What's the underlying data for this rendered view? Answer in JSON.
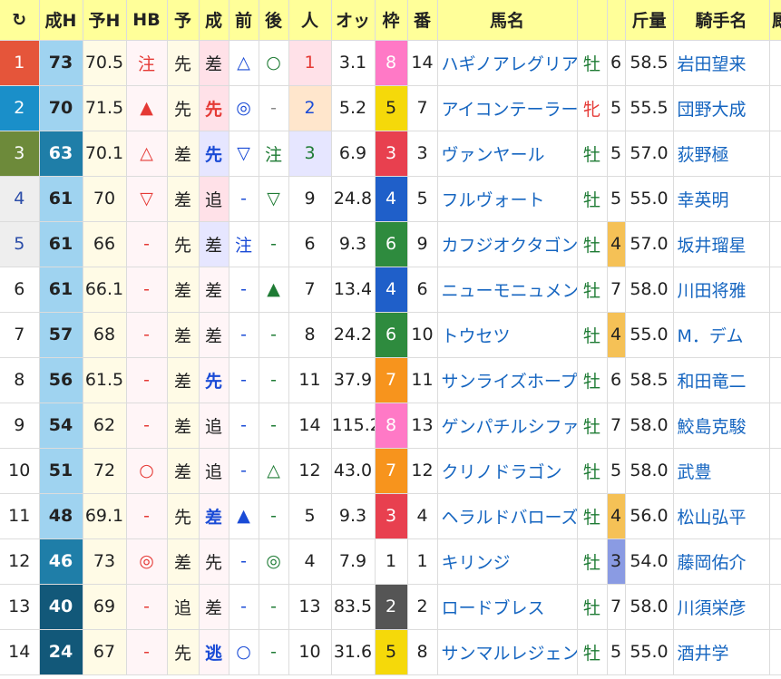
{
  "headers": {
    "refresh": "↻",
    "seiH": "成H",
    "yoH": "予H",
    "hb": "HB",
    "yo": "予",
    "sei": "成",
    "mae": "前",
    "ato": "後",
    "ninki": "人",
    "odds": "オッ",
    "waku": "枠",
    "ban": "番",
    "bamei": "馬名",
    "seirei": "",
    "kinryo": "斤量",
    "kishu": "騎手名",
    "extra": "厩"
  },
  "colors": {
    "header_bg": "#ffff99",
    "waku": {
      "1": "#ffffff",
      "2": "#555555",
      "3": "#e8404f",
      "4": "#1f5fc9",
      "5": "#f5d90a",
      "6": "#2e8b3e",
      "7": "#f7941d",
      "8": "#ff79c6"
    }
  },
  "rows": [
    {
      "rank": "1",
      "rankbg": "#e5553a",
      "rankfg": "#ffffff",
      "seiH": "73",
      "hbc": "blue",
      "yoH": "70.5",
      "hb": "注",
      "hbcls": "red",
      "yo": "先",
      "sei": "差",
      "seicls": "",
      "seibg": "bg-nari-pink",
      "mae": "△",
      "maecls": "blue",
      "ato": "○",
      "atocls": "green",
      "ninki": "1",
      "ninkicls": "red",
      "ninkibg": "bg-pop-pink",
      "odds": "3.1",
      "waku": "8",
      "ban": "14",
      "name": "ハギノアレグリアス",
      "sex": "牡",
      "sexcls": "green",
      "age": "6",
      "agebg": "",
      "kinryo": "58.5",
      "jockey": "岩田望来"
    },
    {
      "rank": "2",
      "rankbg": "#1a8fc9",
      "rankfg": "#ffffff",
      "seiH": "70",
      "hbc": "blue",
      "yoH": "71.5",
      "hb": "▲",
      "hbcls": "red",
      "yo": "先",
      "sei": "先",
      "seicls": "red b",
      "seibg": "bg-nari-pink",
      "mae": "◎",
      "maecls": "blue",
      "ato": "-",
      "atocls": "dash",
      "ninki": "2",
      "ninkicls": "blue",
      "ninkibg": "bg-pop-peach",
      "odds": "5.2",
      "waku": "5",
      "ban": "7",
      "name": "アイコンテーラー",
      "sex": "牝",
      "sexcls": "red",
      "age": "5",
      "agebg": "",
      "kinryo": "55.5",
      "jockey": "団野大成"
    },
    {
      "rank": "3",
      "rankbg": "#6d8a3a",
      "rankfg": "#ffffff",
      "seiH": "63",
      "hbc": "mid",
      "yoH": "70.1",
      "hb": "△",
      "hbcls": "red",
      "yo": "差",
      "sei": "先",
      "seicls": "blue b",
      "seibg": "bg-nari-lav",
      "mae": "▽",
      "maecls": "blue",
      "ato": "注",
      "atocls": "green",
      "ninki": "3",
      "ninkicls": "green",
      "ninkibg": "bg-pop-lav",
      "odds": "6.9",
      "waku": "3",
      "ban": "3",
      "name": "ヴァンヤール",
      "sex": "牡",
      "sexcls": "green",
      "age": "5",
      "agebg": "",
      "kinryo": "57.0",
      "jockey": "荻野極"
    },
    {
      "rank": "4",
      "rankbg": "#eeeeee",
      "rankfg": "#2a4ca8",
      "seiH": "61",
      "hbc": "blue",
      "yoH": "70",
      "hb": "▽",
      "hbcls": "red",
      "yo": "差",
      "sei": "追",
      "seicls": "",
      "seibg": "bg-nari-pink",
      "mae": "-",
      "maecls": "blue",
      "ato": "▽",
      "atocls": "green",
      "ninki": "9",
      "ninkicls": "",
      "ninkibg": "",
      "odds": "24.8",
      "waku": "4",
      "ban": "5",
      "name": "フルヴォート",
      "sex": "牡",
      "sexcls": "green",
      "age": "5",
      "agebg": "",
      "kinryo": "55.0",
      "jockey": "幸英明"
    },
    {
      "rank": "5",
      "rankbg": "#eeeeee",
      "rankfg": "#2a4ca8",
      "seiH": "61",
      "hbc": "blue",
      "yoH": "66",
      "hb": "-",
      "hbcls": "red",
      "yo": "先",
      "sei": "差",
      "seicls": "",
      "seibg": "bg-nari-lav",
      "mae": "注",
      "maecls": "blue",
      "ato": "-",
      "atocls": "green",
      "ninki": "6",
      "ninkicls": "",
      "ninkibg": "",
      "odds": "9.3",
      "waku": "6",
      "ban": "9",
      "name": "カフジオクタゴン",
      "sex": "牡",
      "sexcls": "green",
      "age": "4",
      "agebg": "#f5c156",
      "kinryo": "57.0",
      "jockey": "坂井瑠星"
    },
    {
      "rank": "6",
      "rankbg": "#ffffff",
      "rankfg": "#222222",
      "seiH": "61",
      "hbc": "blue",
      "yoH": "66.1",
      "hb": "-",
      "hbcls": "red",
      "yo": "差",
      "sei": "差",
      "seicls": "",
      "seibg": "",
      "mae": "-",
      "maecls": "blue",
      "ato": "▲",
      "atocls": "green",
      "ninki": "7",
      "ninkicls": "",
      "ninkibg": "",
      "odds": "13.4",
      "waku": "4",
      "ban": "6",
      "name": "ニューモニュメント",
      "sex": "牡",
      "sexcls": "green",
      "age": "7",
      "agebg": "",
      "kinryo": "58.0",
      "jockey": "川田将雅"
    },
    {
      "rank": "7",
      "rankbg": "#ffffff",
      "rankfg": "#222222",
      "seiH": "57",
      "hbc": "blue",
      "yoH": "68",
      "hb": "-",
      "hbcls": "red",
      "yo": "差",
      "sei": "差",
      "seicls": "",
      "seibg": "",
      "mae": "-",
      "maecls": "blue",
      "ato": "-",
      "atocls": "green",
      "ninki": "8",
      "ninkicls": "",
      "ninkibg": "",
      "odds": "24.2",
      "waku": "6",
      "ban": "10",
      "name": "トウセツ",
      "sex": "牡",
      "sexcls": "green",
      "age": "4",
      "agebg": "#f5c156",
      "kinryo": "55.0",
      "jockey": "M．デム"
    },
    {
      "rank": "8",
      "rankbg": "#ffffff",
      "rankfg": "#222222",
      "seiH": "56",
      "hbc": "blue",
      "yoH": "61.5",
      "hb": "-",
      "hbcls": "red",
      "yo": "差",
      "sei": "先",
      "seicls": "blue b",
      "seibg": "",
      "mae": "-",
      "maecls": "blue",
      "ato": "-",
      "atocls": "green",
      "ninki": "11",
      "ninkicls": "",
      "ninkibg": "",
      "odds": "37.9",
      "waku": "7",
      "ban": "11",
      "name": "サンライズホープ",
      "sex": "牡",
      "sexcls": "green",
      "age": "6",
      "agebg": "",
      "kinryo": "58.5",
      "jockey": "和田竜二"
    },
    {
      "rank": "9",
      "rankbg": "#ffffff",
      "rankfg": "#222222",
      "seiH": "54",
      "hbc": "blue",
      "yoH": "62",
      "hb": "-",
      "hbcls": "red",
      "yo": "差",
      "sei": "追",
      "seicls": "",
      "seibg": "",
      "mae": "-",
      "maecls": "blue",
      "ato": "-",
      "atocls": "green",
      "ninki": "14",
      "ninkicls": "",
      "ninkibg": "",
      "odds": "115.2",
      "waku": "8",
      "ban": "13",
      "name": "ゲンパチルシファー",
      "sex": "牡",
      "sexcls": "green",
      "age": "7",
      "agebg": "",
      "kinryo": "58.0",
      "jockey": "鮫島克駿"
    },
    {
      "rank": "10",
      "rankbg": "#ffffff",
      "rankfg": "#222222",
      "seiH": "51",
      "hbc": "blue",
      "yoH": "72",
      "hb": "○",
      "hbcls": "red",
      "yo": "差",
      "sei": "追",
      "seicls": "",
      "seibg": "",
      "mae": "-",
      "maecls": "blue",
      "ato": "△",
      "atocls": "green",
      "ninki": "12",
      "ninkicls": "",
      "ninkibg": "",
      "odds": "43.0",
      "waku": "7",
      "ban": "12",
      "name": "クリノドラゴン",
      "sex": "牡",
      "sexcls": "green",
      "age": "5",
      "agebg": "",
      "kinryo": "58.0",
      "jockey": "武豊"
    },
    {
      "rank": "11",
      "rankbg": "#ffffff",
      "rankfg": "#222222",
      "seiH": "48",
      "hbc": "blue",
      "yoH": "69.1",
      "hb": "-",
      "hbcls": "red",
      "yo": "先",
      "sei": "差",
      "seicls": "blue b",
      "seibg": "",
      "mae": "▲",
      "maecls": "blue",
      "ato": "-",
      "atocls": "green",
      "ninki": "5",
      "ninkicls": "",
      "ninkibg": "",
      "odds": "9.3",
      "waku": "3",
      "ban": "4",
      "name": "ヘラルドバローズ",
      "sex": "牡",
      "sexcls": "green",
      "age": "4",
      "agebg": "#f5c156",
      "kinryo": "56.0",
      "jockey": "松山弘平"
    },
    {
      "rank": "12",
      "rankbg": "#ffffff",
      "rankfg": "#222222",
      "seiH": "46",
      "hbc": "mid",
      "yoH": "73",
      "hb": "◎",
      "hbcls": "red",
      "yo": "差",
      "sei": "先",
      "seicls": "",
      "seibg": "",
      "mae": "-",
      "maecls": "blue",
      "ato": "◎",
      "atocls": "green",
      "ninki": "4",
      "ninkicls": "",
      "ninkibg": "",
      "odds": "7.9",
      "waku": "1",
      "ban": "1",
      "name": "キリンジ",
      "sex": "牡",
      "sexcls": "green",
      "age": "3",
      "agebg": "#8a9be3",
      "kinryo": "54.0",
      "jockey": "藤岡佑介"
    },
    {
      "rank": "13",
      "rankbg": "#ffffff",
      "rankfg": "#222222",
      "seiH": "40",
      "hbc": "dark",
      "yoH": "69",
      "hb": "-",
      "hbcls": "red",
      "yo": "追",
      "sei": "差",
      "seicls": "",
      "seibg": "",
      "mae": "-",
      "maecls": "blue",
      "ato": "-",
      "atocls": "green",
      "ninki": "13",
      "ninkicls": "",
      "ninkibg": "",
      "odds": "83.5",
      "waku": "2",
      "ban": "2",
      "name": "ロードブレス",
      "sex": "牡",
      "sexcls": "green",
      "age": "7",
      "agebg": "",
      "kinryo": "58.0",
      "jockey": "川須栄彦"
    },
    {
      "rank": "14",
      "rankbg": "#ffffff",
      "rankfg": "#222222",
      "seiH": "24",
      "hbc": "dark",
      "yoH": "67",
      "hb": "-",
      "hbcls": "red",
      "yo": "先",
      "sei": "逃",
      "seicls": "blue b",
      "seibg": "",
      "mae": "○",
      "maecls": "blue",
      "ato": "-",
      "atocls": "green",
      "ninki": "10",
      "ninkicls": "",
      "ninkibg": "",
      "odds": "31.6",
      "waku": "5",
      "ban": "8",
      "name": "サンマルレジェンド",
      "sex": "牡",
      "sexcls": "green",
      "age": "5",
      "agebg": "",
      "kinryo": "55.0",
      "jockey": "酒井学"
    }
  ]
}
